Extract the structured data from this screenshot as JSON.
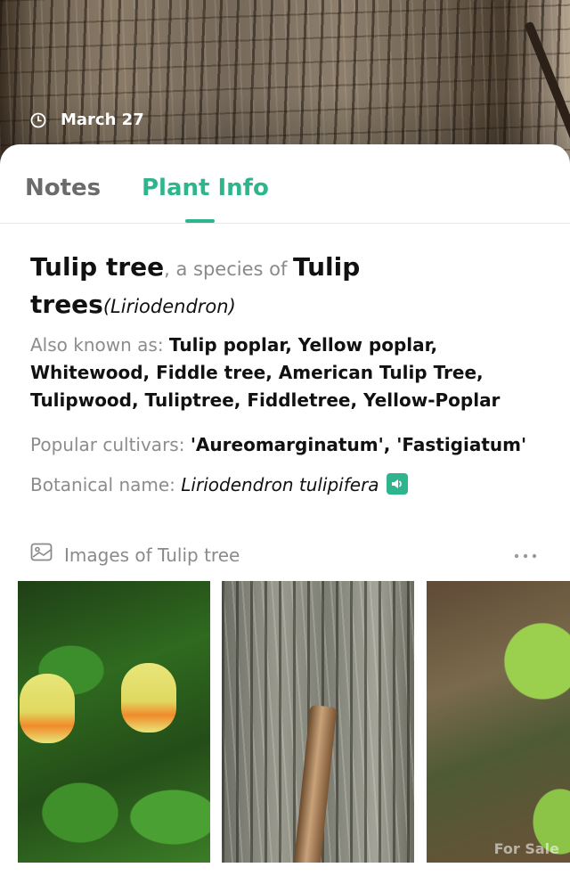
{
  "header": {
    "date": "March 27",
    "clock_icon": "clock-icon"
  },
  "tabs": [
    {
      "label": "Notes",
      "active": false
    },
    {
      "label": "Plant Info",
      "active": true
    }
  ],
  "plant": {
    "common_name": "Tulip tree",
    "species_connector": ", a species of ",
    "genus_common": "Tulip trees",
    "genus_scientific": "(Liriodendron)",
    "aka_label": "Also known as: ",
    "aka_value": "Tulip poplar, Yellow poplar, Whitewood, Fiddle tree, American Tulip Tree, Tulipwood, Tuliptree, Fiddletree, Yellow-Poplar",
    "cultivars_label": "Popular cultivars: ",
    "cultivars_value": "'Aureomarginatum', 'Fastigiatum'",
    "botanical_label": "Botanical name: ",
    "botanical_value": "Liriodendron tulipifera",
    "sound_icon": "speaker-icon"
  },
  "images_section": {
    "heading": "Images of Tulip tree",
    "heading_icon": "image-gallery-icon",
    "more_icon": "more-dots-icon",
    "images": [
      {
        "subject": "tulip-flowers-photo"
      },
      {
        "subject": "bark-photo"
      },
      {
        "subject": "leaf-photo",
        "watermark": "For Sale"
      }
    ]
  },
  "colors": {
    "accent": "#2fb58d",
    "muted_text": "#8c8c8c",
    "primary_text": "#111111"
  }
}
